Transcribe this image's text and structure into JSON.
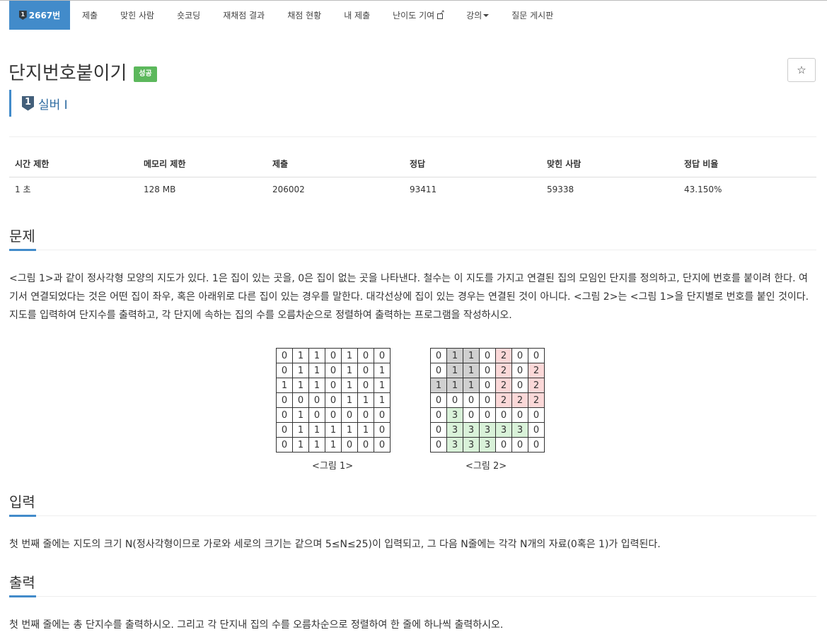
{
  "nav": {
    "problem_number": "2667번",
    "badge_digit": "1",
    "tabs": [
      "제출",
      "맞힌 사람",
      "숏코딩",
      "재채점 결과",
      "채점 현황",
      "내 제출",
      "난이도 기여",
      "강의",
      "질문 게시판"
    ]
  },
  "problem": {
    "title": "단지번호붙이기",
    "status_label": "성공",
    "star": "☆",
    "tier_digit": "1",
    "tier": "실버 I"
  },
  "info_table": {
    "headers": [
      "시간 제한",
      "메모리 제한",
      "제출",
      "정답",
      "맞힌 사람",
      "정답 비율"
    ],
    "values": [
      "1 초",
      "128 MB",
      "206002",
      "93411",
      "59338",
      "43.150%"
    ]
  },
  "sections": {
    "problem_heading": "문제",
    "problem_text": "<그림 1>과 같이 정사각형 모양의 지도가 있다. 1은 집이 있는 곳을, 0은 집이 없는 곳을 나타낸다. 철수는 이 지도를 가지고 연결된 집의 모임인 단지를 정의하고, 단지에 번호를 붙이려 한다. 여기서 연결되었다는 것은 어떤 집이 좌우, 혹은 아래위로 다른 집이 있는 경우를 말한다. 대각선상에 집이 있는 경우는 연결된 것이 아니다. <그림 2>는 <그림 1>을 단지별로 번호를 붙인 것이다. 지도를 입력하여 단지수를 출력하고, 각 단지에 속하는 집의 수를 오름차순으로 정렬하여 출력하는 프로그램을 작성하시오.",
    "input_heading": "입력",
    "input_text": "첫 번째 줄에는 지도의 크기 N(정사각형이므로 가로와 세로의 크기는 같으며 5≤N≤25)이 입력되고, 그 다음 N줄에는 각각 N개의 자료(0혹은 1)가 입력된다.",
    "output_heading": "출력",
    "output_text": "첫 번째 줄에는 총 단지수를 출력하시오. 그리고 각 단지내 집의 수를 오름차순으로 정렬하여 한 줄에 하나씩 출력하시오."
  },
  "figures": {
    "figure1": {
      "caption": "<그림 1>",
      "rows": [
        [
          "0",
          "1",
          "1",
          "0",
          "1",
          "0",
          "0"
        ],
        [
          "0",
          "1",
          "1",
          "0",
          "1",
          "0",
          "1"
        ],
        [
          "1",
          "1",
          "1",
          "0",
          "1",
          "0",
          "1"
        ],
        [
          "0",
          "0",
          "0",
          "0",
          "1",
          "1",
          "1"
        ],
        [
          "0",
          "1",
          "0",
          "0",
          "0",
          "0",
          "0"
        ],
        [
          "0",
          "1",
          "1",
          "1",
          "1",
          "1",
          "0"
        ],
        [
          "0",
          "1",
          "1",
          "1",
          "0",
          "0",
          "0"
        ]
      ]
    },
    "figure2": {
      "caption": "<그림 2>",
      "rows": [
        [
          "0",
          "1",
          "1",
          "0",
          "2",
          "0",
          "0"
        ],
        [
          "0",
          "1",
          "1",
          "0",
          "2",
          "0",
          "2"
        ],
        [
          "1",
          "1",
          "1",
          "0",
          "2",
          "0",
          "2"
        ],
        [
          "0",
          "0",
          "0",
          "0",
          "2",
          "2",
          "2"
        ],
        [
          "0",
          "3",
          "0",
          "0",
          "0",
          "0",
          "0"
        ],
        [
          "0",
          "3",
          "3",
          "3",
          "3",
          "3",
          "0"
        ],
        [
          "0",
          "3",
          "3",
          "3",
          "0",
          "0",
          "0"
        ]
      ],
      "group_colors": {
        "1": "#d0d0d0",
        "2": "#fbd8d8",
        "3": "#d9f2d9"
      }
    }
  }
}
